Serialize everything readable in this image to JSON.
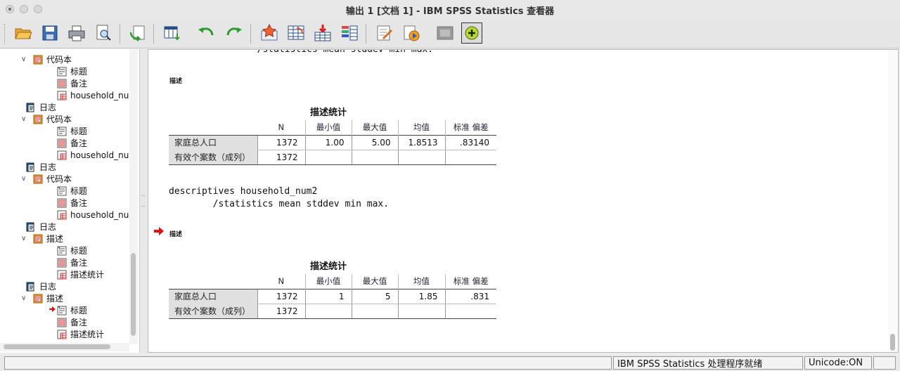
{
  "window": {
    "title": "输出 1 [文档 1] - IBM SPSS Statistics 查看器"
  },
  "toolbar": {
    "icons": [
      "open-folder-icon",
      "save-icon",
      "print-icon",
      "print-preview-icon",
      "goto-data-icon",
      "goto-variable-icon",
      "undo-icon",
      "redo-icon",
      "star-output-icon",
      "pivot-table-icon",
      "insert-data-icon",
      "variables-icon",
      "insert-text-icon",
      "show-icon",
      "hide-icon",
      "promote-icon"
    ]
  },
  "outline": {
    "nodes": [
      {
        "label": "代码本",
        "type": "book",
        "depth": 0,
        "twisty": "v"
      },
      {
        "label": "标题",
        "type": "title",
        "depth": 1
      },
      {
        "label": "备注",
        "type": "notes",
        "depth": 1
      },
      {
        "label": "household_nur",
        "type": "table",
        "depth": 1
      },
      {
        "label": "日志",
        "type": "log",
        "depth": 0
      },
      {
        "label": "代码本",
        "type": "book",
        "depth": 0,
        "twisty": "v"
      },
      {
        "label": "标题",
        "type": "title",
        "depth": 1
      },
      {
        "label": "备注",
        "type": "notes",
        "depth": 1
      },
      {
        "label": "household_nur",
        "type": "table",
        "depth": 1
      },
      {
        "label": "日志",
        "type": "log",
        "depth": 0
      },
      {
        "label": "代码本",
        "type": "book",
        "depth": 0,
        "twisty": "v"
      },
      {
        "label": "标题",
        "type": "title",
        "depth": 1
      },
      {
        "label": "备注",
        "type": "notes",
        "depth": 1
      },
      {
        "label": "household_nur",
        "type": "table",
        "depth": 1
      },
      {
        "label": "日志",
        "type": "log",
        "depth": 0
      },
      {
        "label": "描述",
        "type": "book",
        "depth": 0,
        "twisty": "v"
      },
      {
        "label": "标题",
        "type": "title",
        "depth": 1
      },
      {
        "label": "备注",
        "type": "notes",
        "depth": 1
      },
      {
        "label": "描述统计",
        "type": "table",
        "depth": 1
      },
      {
        "label": "日志",
        "type": "log",
        "depth": 0
      },
      {
        "label": "描述",
        "type": "book",
        "depth": 0,
        "twisty": "v"
      },
      {
        "label": "标题",
        "type": "title",
        "depth": 1,
        "current": true
      },
      {
        "label": "备注",
        "type": "notes",
        "depth": 1
      },
      {
        "label": "描述统计",
        "type": "table",
        "depth": 1
      }
    ]
  },
  "output": {
    "clipped_code": "        /statistics mean stddev min max.",
    "block1": {
      "heading": "描述",
      "table_title": "描述统计",
      "headers": [
        "N",
        "最小值",
        "最大值",
        "均值",
        "标准 偏差"
      ],
      "rows": [
        {
          "label": "家庭总人口",
          "values": [
            "1372",
            "1.00",
            "5.00",
            "1.8513",
            ".83140"
          ]
        },
        {
          "label": "有效个案数（成列）",
          "values": [
            "1372",
            "",
            "",
            "",
            ""
          ]
        }
      ]
    },
    "code2_line1": "descriptives household_num2",
    "code2_line2": "        /statistics mean stddev min max.",
    "block2": {
      "heading": "描述",
      "table_title": "描述统计",
      "headers": [
        "N",
        "最小值",
        "最大值",
        "均值",
        "标准 偏差"
      ],
      "rows": [
        {
          "label": "家庭总人口",
          "values": [
            "1372",
            "1",
            "5",
            "1.85",
            ".831"
          ]
        },
        {
          "label": "有效个案数（成列）",
          "values": [
            "1372",
            "",
            "",
            "",
            ""
          ]
        }
      ]
    }
  },
  "status": {
    "message": "IBM SPSS Statistics 处理程序就绪",
    "unicode": "Unicode:ON"
  }
}
